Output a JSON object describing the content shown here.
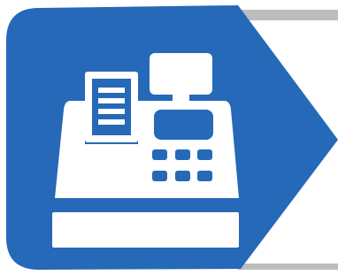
{
  "graphic": {
    "icon": "cash-register-icon",
    "colors": {
      "background": "#ffffff",
      "badge_fill": "#2569b8",
      "icon_fill": "#ffffff",
      "frame_fill": "#ffffff",
      "frame_shadow": "#bdbdbd"
    }
  }
}
